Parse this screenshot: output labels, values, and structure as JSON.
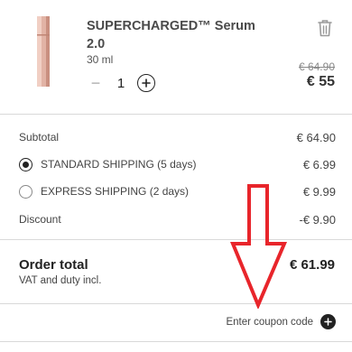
{
  "product": {
    "name": "SUPERCHARGED™ Serum 2.0",
    "size": "30 ml",
    "quantity": "1",
    "original_price": "€ 64.90",
    "price": "€ 55",
    "minus_symbol": "−"
  },
  "summary": {
    "subtotal_label": "Subtotal",
    "subtotal_value": "€ 64.90",
    "shipping_options": [
      {
        "label": "STANDARD SHIPPING (5 days)",
        "value": "€ 6.99",
        "selected": true
      },
      {
        "label": "EXPRESS SHIPPING (2 days)",
        "value": "€ 9.99",
        "selected": false
      }
    ],
    "discount_label": "Discount",
    "discount_value": "-€ 9.90",
    "total_label": "Order total",
    "total_value": "€ 61.99",
    "vat_note": "VAT and duty incl."
  },
  "coupon": {
    "label": "Enter coupon code"
  },
  "colors": {
    "annotation_arrow": "#e8252b",
    "text": "#2a2a2a",
    "divider": "#d9d9d9",
    "bottle": "#d9a898"
  },
  "icons": [
    "trash-icon",
    "minus-icon",
    "plus-icon",
    "radio-checked-icon",
    "radio-unchecked-icon",
    "plus-circle-icon",
    "red-down-arrow-annotation"
  ]
}
